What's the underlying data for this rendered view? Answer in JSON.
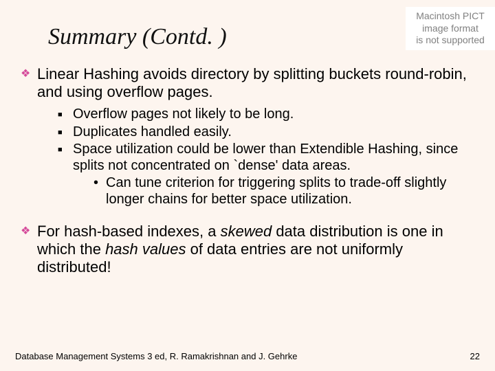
{
  "title": "Summary (Contd. )",
  "placeholder": {
    "l1": "Macintosh PICT",
    "l2": "image format",
    "l3": "is not supported"
  },
  "p1a": "Linear Hashing avoids directory by splitting buckets round-robin, and using overflow pages.",
  "s1": "Overflow pages not likely to be long.",
  "s2": "Duplicates handled easily.",
  "s3": "Space utilization could be lower than Extendible Hashing, since splits not concentrated on `dense' data areas.",
  "s3a": "Can tune criterion for triggering splits to trade-off slightly longer chains for better space utilization.",
  "p2_pre": "For hash-based indexes, a ",
  "p2_em1": "skewed",
  "p2_mid": " data distribution is one in which the ",
  "p2_em2": "hash values",
  "p2_post": " of data entries are not uniformly distributed!",
  "footer_left": "Database Management Systems 3 ed,  R. Ramakrishnan and J. Gehrke",
  "footer_right": "22"
}
